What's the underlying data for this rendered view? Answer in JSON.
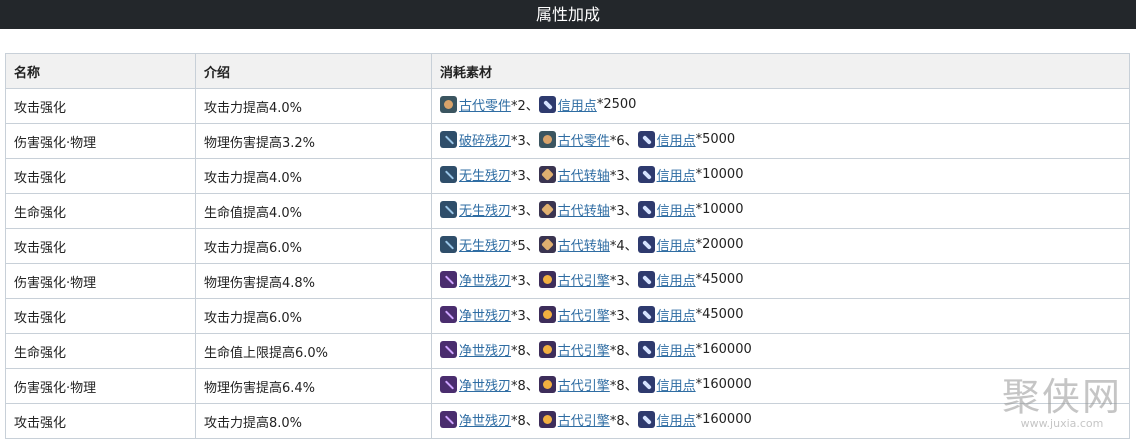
{
  "header": {
    "title": "属性加成"
  },
  "table": {
    "columns": [
      "名称",
      "介绍",
      "消耗素材"
    ],
    "rows": [
      {
        "name": "攻击强化",
        "desc": "攻击力提高4.0%",
        "materials": [
          {
            "icon": "ancient-part-icon",
            "label": "古代零件",
            "qty": "*2、"
          },
          {
            "icon": "credit-icon",
            "label": "信用点",
            "qty": "*2500"
          }
        ]
      },
      {
        "name": "伤害强化·物理",
        "desc": "物理伤害提高3.2%",
        "materials": [
          {
            "icon": "shattered-blade-icon",
            "label": "破碎残刃",
            "qty": "*3、"
          },
          {
            "icon": "ancient-part-icon",
            "label": "古代零件",
            "qty": "*6、"
          },
          {
            "icon": "credit-icon",
            "label": "信用点",
            "qty": "*5000"
          }
        ]
      },
      {
        "name": "攻击强化",
        "desc": "攻击力提高4.0%",
        "materials": [
          {
            "icon": "lifeless-blade-icon",
            "label": "无生残刃",
            "qty": "*3、"
          },
          {
            "icon": "ancient-spindle-icon",
            "label": "古代转轴",
            "qty": "*3、"
          },
          {
            "icon": "credit-icon",
            "label": "信用点",
            "qty": "*10000"
          }
        ]
      },
      {
        "name": "生命强化",
        "desc": "生命值提高4.0%",
        "materials": [
          {
            "icon": "lifeless-blade-icon",
            "label": "无生残刃",
            "qty": "*3、"
          },
          {
            "icon": "ancient-spindle-icon",
            "label": "古代转轴",
            "qty": "*3、"
          },
          {
            "icon": "credit-icon",
            "label": "信用点",
            "qty": "*10000"
          }
        ]
      },
      {
        "name": "攻击强化",
        "desc": "攻击力提高6.0%",
        "materials": [
          {
            "icon": "lifeless-blade-icon",
            "label": "无生残刃",
            "qty": "*5、"
          },
          {
            "icon": "ancient-spindle-icon",
            "label": "古代转轴",
            "qty": "*4、"
          },
          {
            "icon": "credit-icon",
            "label": "信用点",
            "qty": "*20000"
          }
        ]
      },
      {
        "name": "伤害强化·物理",
        "desc": "物理伤害提高4.8%",
        "materials": [
          {
            "icon": "purifying-blade-icon",
            "label": "净世残刃",
            "qty": "*3、"
          },
          {
            "icon": "ancient-engine-icon",
            "label": "古代引擎",
            "qty": "*3、"
          },
          {
            "icon": "credit-icon",
            "label": "信用点",
            "qty": "*45000"
          }
        ]
      },
      {
        "name": "攻击强化",
        "desc": "攻击力提高6.0%",
        "materials": [
          {
            "icon": "purifying-blade-icon",
            "label": "净世残刃",
            "qty": "*3、"
          },
          {
            "icon": "ancient-engine-icon",
            "label": "古代引擎",
            "qty": "*3、"
          },
          {
            "icon": "credit-icon",
            "label": "信用点",
            "qty": "*45000"
          }
        ]
      },
      {
        "name": "生命强化",
        "desc": "生命值上限提高6.0%",
        "materials": [
          {
            "icon": "purifying-blade-icon",
            "label": "净世残刃",
            "qty": "*8、"
          },
          {
            "icon": "ancient-engine-icon",
            "label": "古代引擎",
            "qty": "*8、"
          },
          {
            "icon": "credit-icon",
            "label": "信用点",
            "qty": "*160000"
          }
        ]
      },
      {
        "name": "伤害强化·物理",
        "desc": "物理伤害提高6.4%",
        "materials": [
          {
            "icon": "purifying-blade-icon",
            "label": "净世残刃",
            "qty": "*8、"
          },
          {
            "icon": "ancient-engine-icon",
            "label": "古代引擎",
            "qty": "*8、"
          },
          {
            "icon": "credit-icon",
            "label": "信用点",
            "qty": "*160000"
          }
        ]
      },
      {
        "name": "攻击强化",
        "desc": "攻击力提高8.0%",
        "materials": [
          {
            "icon": "purifying-blade-icon",
            "label": "净世残刃",
            "qty": "*8、"
          },
          {
            "icon": "ancient-engine-icon",
            "label": "古代引擎",
            "qty": "*8、"
          },
          {
            "icon": "credit-icon",
            "label": "信用点",
            "qty": "*160000"
          }
        ]
      }
    ]
  },
  "watermark": {
    "text": "聚侠网",
    "url": "www.juxia.com"
  }
}
